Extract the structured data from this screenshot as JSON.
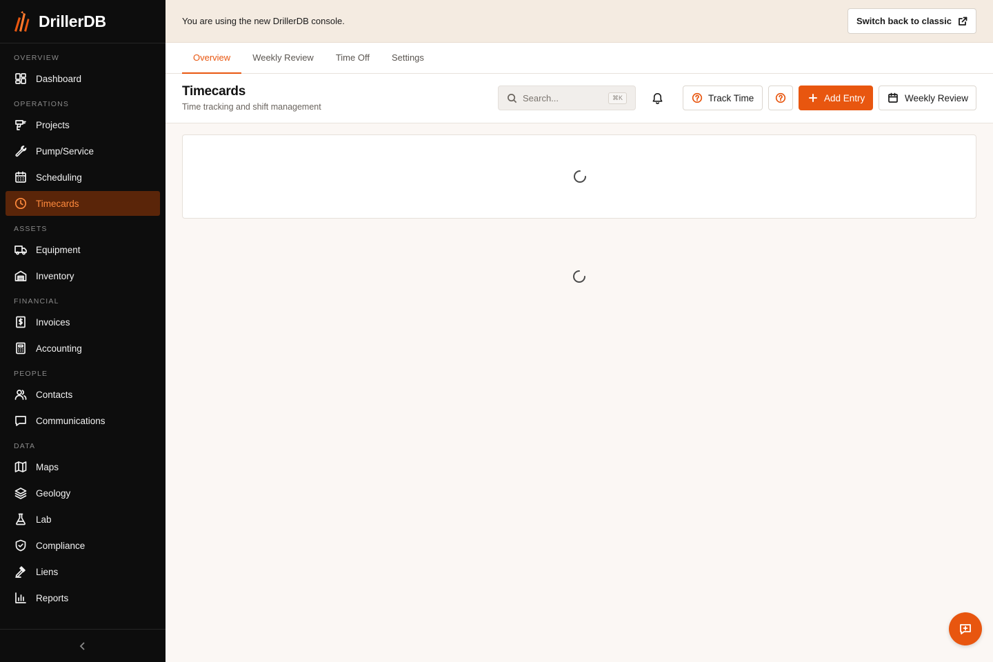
{
  "app": {
    "name": "DrillerDB",
    "accent": "#e8560f"
  },
  "banner": {
    "text": "You are using the new DrillerDB console.",
    "button_label": "Switch back to classic"
  },
  "sidebar": {
    "groups": [
      {
        "heading": "OVERVIEW",
        "items": [
          {
            "label": "Dashboard",
            "icon": "dashboard-icon"
          }
        ]
      },
      {
        "heading": "OPERATIONS",
        "items": [
          {
            "label": "Projects",
            "icon": "drill-icon"
          },
          {
            "label": "Pump/Service",
            "icon": "wrench-icon"
          },
          {
            "label": "Scheduling",
            "icon": "calendar-icon"
          },
          {
            "label": "Timecards",
            "icon": "clock-icon",
            "active": true
          }
        ]
      },
      {
        "heading": "ASSETS",
        "items": [
          {
            "label": "Equipment",
            "icon": "truck-icon"
          },
          {
            "label": "Inventory",
            "icon": "warehouse-icon"
          }
        ]
      },
      {
        "heading": "FINANCIAL",
        "items": [
          {
            "label": "Invoices",
            "icon": "invoice-icon"
          },
          {
            "label": "Accounting",
            "icon": "calculator-icon"
          }
        ]
      },
      {
        "heading": "PEOPLE",
        "items": [
          {
            "label": "Contacts",
            "icon": "users-icon"
          },
          {
            "label": "Communications",
            "icon": "message-icon"
          }
        ]
      },
      {
        "heading": "DATA",
        "items": [
          {
            "label": "Maps",
            "icon": "map-icon"
          },
          {
            "label": "Geology",
            "icon": "layers-icon"
          },
          {
            "label": "Lab",
            "icon": "flask-icon"
          },
          {
            "label": "Compliance",
            "icon": "shield-icon"
          },
          {
            "label": "Liens",
            "icon": "gavel-icon"
          },
          {
            "label": "Reports",
            "icon": "bar-chart-icon"
          }
        ]
      }
    ]
  },
  "tabs": [
    {
      "label": "Overview",
      "active": true
    },
    {
      "label": "Weekly Review"
    },
    {
      "label": "Time Off"
    },
    {
      "label": "Settings"
    }
  ],
  "header": {
    "title": "Timecards",
    "subtitle": "Time tracking and shift management",
    "search_placeholder": "Search...",
    "search_shortcut": "⌘K",
    "track_time_label": "Track Time",
    "add_entry_label": "Add Entry",
    "weekly_review_label": "Weekly Review"
  }
}
